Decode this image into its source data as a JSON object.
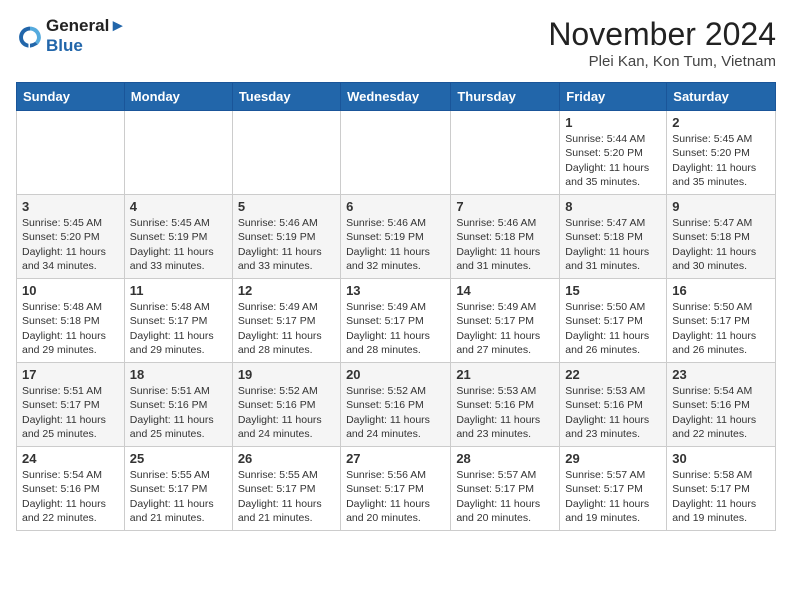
{
  "header": {
    "logo_line1": "General",
    "logo_line2": "Blue",
    "month_title": "November 2024",
    "location": "Plei Kan, Kon Tum, Vietnam"
  },
  "weekdays": [
    "Sunday",
    "Monday",
    "Tuesday",
    "Wednesday",
    "Thursday",
    "Friday",
    "Saturday"
  ],
  "weeks": [
    [
      {
        "day": "",
        "content": ""
      },
      {
        "day": "",
        "content": ""
      },
      {
        "day": "",
        "content": ""
      },
      {
        "day": "",
        "content": ""
      },
      {
        "day": "",
        "content": ""
      },
      {
        "day": "1",
        "content": "Sunrise: 5:44 AM\nSunset: 5:20 PM\nDaylight: 11 hours and 35 minutes."
      },
      {
        "day": "2",
        "content": "Sunrise: 5:45 AM\nSunset: 5:20 PM\nDaylight: 11 hours and 35 minutes."
      }
    ],
    [
      {
        "day": "3",
        "content": "Sunrise: 5:45 AM\nSunset: 5:20 PM\nDaylight: 11 hours and 34 minutes."
      },
      {
        "day": "4",
        "content": "Sunrise: 5:45 AM\nSunset: 5:19 PM\nDaylight: 11 hours and 33 minutes."
      },
      {
        "day": "5",
        "content": "Sunrise: 5:46 AM\nSunset: 5:19 PM\nDaylight: 11 hours and 33 minutes."
      },
      {
        "day": "6",
        "content": "Sunrise: 5:46 AM\nSunset: 5:19 PM\nDaylight: 11 hours and 32 minutes."
      },
      {
        "day": "7",
        "content": "Sunrise: 5:46 AM\nSunset: 5:18 PM\nDaylight: 11 hours and 31 minutes."
      },
      {
        "day": "8",
        "content": "Sunrise: 5:47 AM\nSunset: 5:18 PM\nDaylight: 11 hours and 31 minutes."
      },
      {
        "day": "9",
        "content": "Sunrise: 5:47 AM\nSunset: 5:18 PM\nDaylight: 11 hours and 30 minutes."
      }
    ],
    [
      {
        "day": "10",
        "content": "Sunrise: 5:48 AM\nSunset: 5:18 PM\nDaylight: 11 hours and 29 minutes."
      },
      {
        "day": "11",
        "content": "Sunrise: 5:48 AM\nSunset: 5:17 PM\nDaylight: 11 hours and 29 minutes."
      },
      {
        "day": "12",
        "content": "Sunrise: 5:49 AM\nSunset: 5:17 PM\nDaylight: 11 hours and 28 minutes."
      },
      {
        "day": "13",
        "content": "Sunrise: 5:49 AM\nSunset: 5:17 PM\nDaylight: 11 hours and 28 minutes."
      },
      {
        "day": "14",
        "content": "Sunrise: 5:49 AM\nSunset: 5:17 PM\nDaylight: 11 hours and 27 minutes."
      },
      {
        "day": "15",
        "content": "Sunrise: 5:50 AM\nSunset: 5:17 PM\nDaylight: 11 hours and 26 minutes."
      },
      {
        "day": "16",
        "content": "Sunrise: 5:50 AM\nSunset: 5:17 PM\nDaylight: 11 hours and 26 minutes."
      }
    ],
    [
      {
        "day": "17",
        "content": "Sunrise: 5:51 AM\nSunset: 5:17 PM\nDaylight: 11 hours and 25 minutes."
      },
      {
        "day": "18",
        "content": "Sunrise: 5:51 AM\nSunset: 5:16 PM\nDaylight: 11 hours and 25 minutes."
      },
      {
        "day": "19",
        "content": "Sunrise: 5:52 AM\nSunset: 5:16 PM\nDaylight: 11 hours and 24 minutes."
      },
      {
        "day": "20",
        "content": "Sunrise: 5:52 AM\nSunset: 5:16 PM\nDaylight: 11 hours and 24 minutes."
      },
      {
        "day": "21",
        "content": "Sunrise: 5:53 AM\nSunset: 5:16 PM\nDaylight: 11 hours and 23 minutes."
      },
      {
        "day": "22",
        "content": "Sunrise: 5:53 AM\nSunset: 5:16 PM\nDaylight: 11 hours and 23 minutes."
      },
      {
        "day": "23",
        "content": "Sunrise: 5:54 AM\nSunset: 5:16 PM\nDaylight: 11 hours and 22 minutes."
      }
    ],
    [
      {
        "day": "24",
        "content": "Sunrise: 5:54 AM\nSunset: 5:16 PM\nDaylight: 11 hours and 22 minutes."
      },
      {
        "day": "25",
        "content": "Sunrise: 5:55 AM\nSunset: 5:17 PM\nDaylight: 11 hours and 21 minutes."
      },
      {
        "day": "26",
        "content": "Sunrise: 5:55 AM\nSunset: 5:17 PM\nDaylight: 11 hours and 21 minutes."
      },
      {
        "day": "27",
        "content": "Sunrise: 5:56 AM\nSunset: 5:17 PM\nDaylight: 11 hours and 20 minutes."
      },
      {
        "day": "28",
        "content": "Sunrise: 5:57 AM\nSunset: 5:17 PM\nDaylight: 11 hours and 20 minutes."
      },
      {
        "day": "29",
        "content": "Sunrise: 5:57 AM\nSunset: 5:17 PM\nDaylight: 11 hours and 19 minutes."
      },
      {
        "day": "30",
        "content": "Sunrise: 5:58 AM\nSunset: 5:17 PM\nDaylight: 11 hours and 19 minutes."
      }
    ]
  ]
}
